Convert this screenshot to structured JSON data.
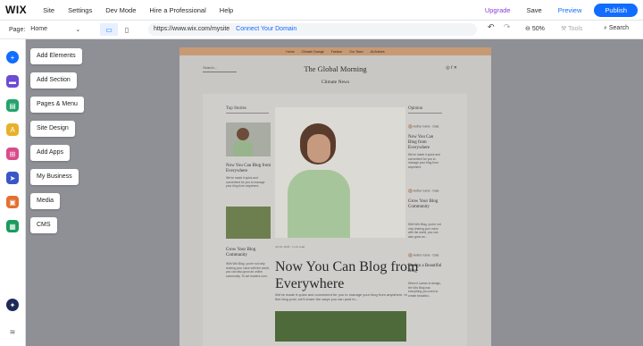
{
  "topbar": {
    "logo": "WIX",
    "menu": [
      "Site",
      "Settings",
      "Dev Mode",
      "Hire a Professional",
      "Help"
    ],
    "upgrade": "Upgrade",
    "save": "Save",
    "preview": "Preview",
    "publish": "Publish"
  },
  "secondbar": {
    "page_label": "Page:",
    "page_value": "Home",
    "url": "https://www.wix.com/mysite",
    "connect": "Connect Your Domain",
    "zoom": "50%",
    "tools": "Tools",
    "search": "Search"
  },
  "leftpanel": {
    "items": [
      "Add Elements",
      "Add Section",
      "Pages & Menu",
      "Site Design",
      "Add Apps",
      "My Business",
      "Media",
      "CMS"
    ]
  },
  "site": {
    "ribbon": [
      "Home",
      "Climate Change",
      "Fashion",
      "Our Team",
      "All Articles"
    ],
    "search_placeholder": "Search...",
    "title": "The Global Morning",
    "section": "Climate News",
    "top_stories": "Top Stories",
    "opinion": "Opinion",
    "story1_title": "Now You Can Blog from Everywhere",
    "story1_text": "We've made it quick and convenient for you to manage your blog from anywhere.",
    "story2_title": "Grow Your Blog Community",
    "story2_text": "With Wix Blog, you're not only sharing your voice with the world, you can also grow an online community. To set readers com...",
    "main_meta": "Jul 20, 2023 · 1 min read",
    "main_title": "Now You Can Blog from Everywhere",
    "main_text": "We've made it quick and convenient for you to manage your blog from anywhere. In this blog post, we'll share the ways you can post to...",
    "op1_title": "Now You Can Blog from Everywhere",
    "op1_text": "We've made it quick and convenient for you to manage your blog from anywhere.",
    "op2_title": "Grow Your Blog Community",
    "op2_text": "With Wix Blog, you're not only sharing your voice with the world, you can also grow an...",
    "op3_title": "Design a Beautiful Blog",
    "op3_text": "When it comes to design, the Wix Blog has everything you need to create beautiful...",
    "author": "Author name · Date"
  },
  "colors": {
    "accent": "#116dff",
    "upgrade": "#8b3dd8",
    "ribbon": "#c79a74"
  }
}
